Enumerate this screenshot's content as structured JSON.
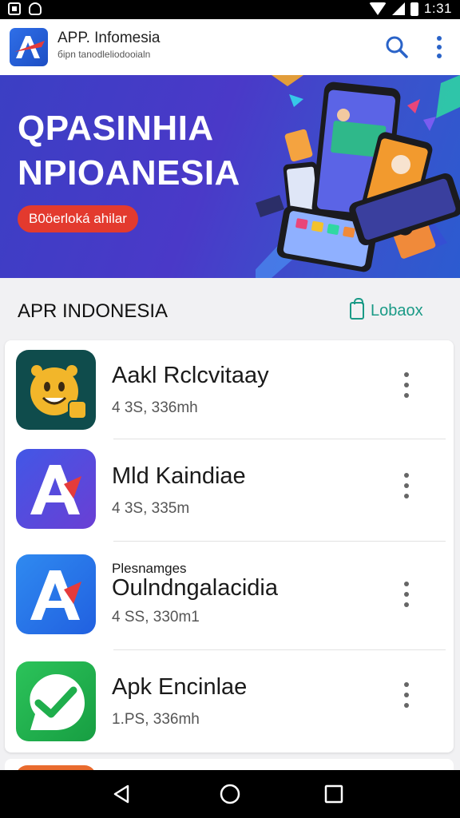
{
  "status_bar": {
    "time": "1:31"
  },
  "app_bar": {
    "title": "APP. Infomesia",
    "subtitle": "бipn tanodleliodooialn",
    "icons": [
      "app-logo",
      "search-icon",
      "more-vert-icon"
    ]
  },
  "banner": {
    "line1": "QPASINHIA",
    "line2": "NPIOANESIA",
    "cta_label": "B0öerloká ahilar"
  },
  "section": {
    "title": "APR INDONESIA",
    "action_label": "Lobaox",
    "action_icon": "shopping-bag-icon"
  },
  "apps": [
    {
      "name": "Aakl Rclcvitaay",
      "overline": "",
      "meta": "4 3S, 336mh",
      "icon": "smiley-app-icon",
      "icon_colors": [
        "#0f4c4c",
        "#f2b62a"
      ]
    },
    {
      "name": "Mld Kaindiae",
      "overline": "",
      "meta": "4 3S, 335m",
      "icon": "letter-a-app-icon",
      "icon_colors": [
        "#3b4fdc",
        "#e53b3b"
      ]
    },
    {
      "name": "Oulndngalacidia",
      "overline": "Plesnamges",
      "meta": "4 SS, 330m1",
      "icon": "letter-a-app-icon",
      "icon_colors": [
        "#2f7fe6",
        "#e53b3b"
      ]
    },
    {
      "name": "Apk Encinlae",
      "overline": "",
      "meta": "1.PS, 336mh",
      "icon": "check-leaf-app-icon",
      "icon_colors": [
        "#22b04b",
        "#ffffff"
      ]
    }
  ],
  "nav_bar": {
    "icons": [
      "back-icon",
      "home-icon",
      "recents-icon"
    ]
  }
}
